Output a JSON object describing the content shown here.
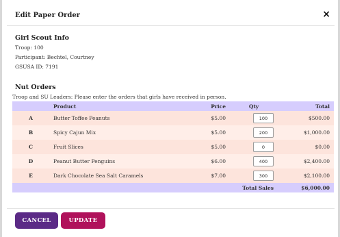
{
  "modal": {
    "title": "Edit Paper Order",
    "close_label": "×"
  },
  "scout_info": {
    "heading": "Girl Scout Info",
    "troop": "Troop: 100",
    "participant": "Participant: Bechtel, Courtney",
    "gsusa_id": "GSUSA ID: 7191"
  },
  "nut_orders": {
    "heading": "Nut Orders",
    "intro": "Troop and SU Leaders: Please enter the orders that girls have received in person.",
    "headers": {
      "letter": "",
      "product": "Product",
      "price": "Price",
      "qty": "Qty",
      "total": "Total"
    },
    "rows": [
      {
        "letter": "A",
        "product": "Butter Toffee Peanuts",
        "price": "$5.00",
        "qty": "100",
        "total": "$500.00"
      },
      {
        "letter": "B",
        "product": "Spicy Cajun Mix",
        "price": "$5.00",
        "qty": "200",
        "total": "$1,000.00"
      },
      {
        "letter": "C",
        "product": "Fruit Slices",
        "price": "$5.00",
        "qty": "0",
        "total": "$0.00"
      },
      {
        "letter": "D",
        "product": "Peanut Butter Penguins",
        "price": "$6.00",
        "qty": "400",
        "total": "$2,400.00"
      },
      {
        "letter": "E",
        "product": "Dark Chocolate Sea Salt Caramels",
        "price": "$7.00",
        "qty": "300",
        "total": "$2,100.00"
      }
    ],
    "total_label": "Total Sales",
    "total_value": "$6,000.00"
  },
  "buttons": {
    "cancel": "CANCEL",
    "update": "UPDATE"
  },
  "colors": {
    "header_row": "#d6cdfd",
    "row_odd": "#fde4dc",
    "row_even": "#ffeee8",
    "cancel_button": "#5b2a86",
    "update_button": "#b0125b"
  }
}
